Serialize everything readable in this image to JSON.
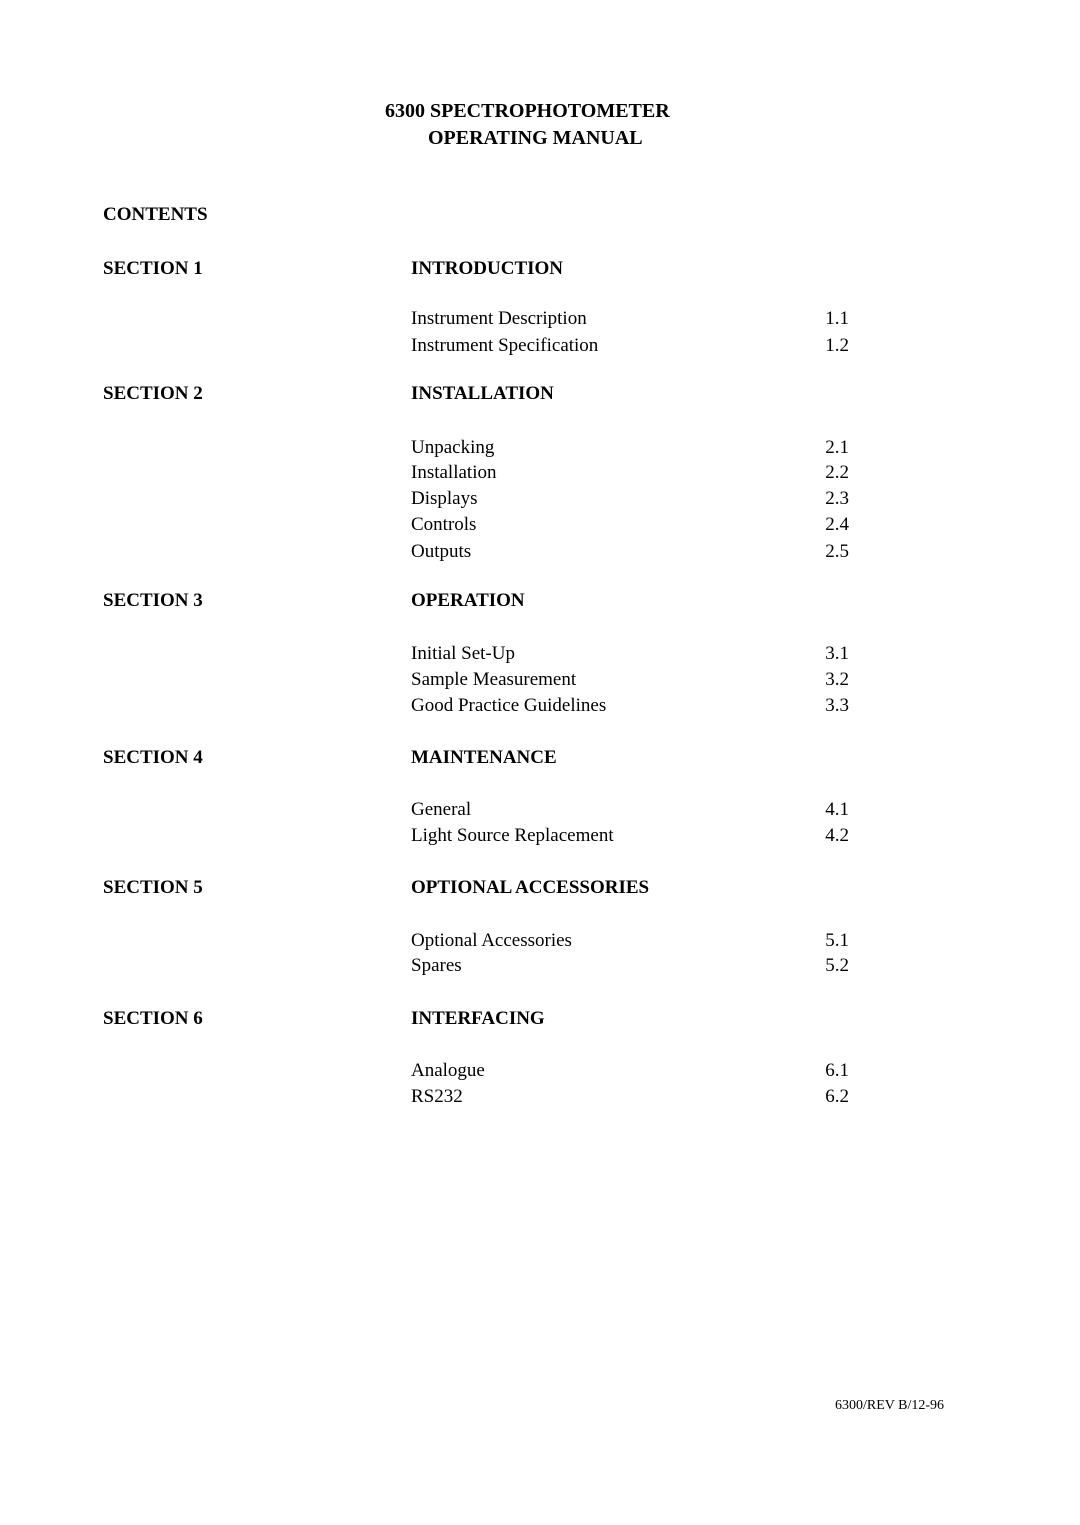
{
  "document": {
    "title_line1": "6300 SPECTROPHOTOMETER",
    "title_line2": "OPERATING MANUAL",
    "contents_label": "CONTENTS",
    "footer": "6300/REV  B/12-96"
  },
  "sections": [
    {
      "label": "SECTION 1",
      "title": "INTRODUCTION",
      "items": [
        {
          "name": "Instrument Description",
          "num": "1.1"
        },
        {
          "name": "Instrument Specification",
          "num": "1.2"
        }
      ]
    },
    {
      "label": "SECTION 2",
      "title": "INSTALLATION",
      "items": [
        {
          "name": "Unpacking",
          "num": "2.1"
        },
        {
          "name": "Installation",
          "num": "2.2"
        },
        {
          "name": "Displays",
          "num": "2.3"
        },
        {
          "name": "Controls",
          "num": "2.4"
        },
        {
          "name": "Outputs",
          "num": "2.5"
        }
      ]
    },
    {
      "label": "SECTION 3",
      "title": "OPERATION",
      "items": [
        {
          "name": "Initial Set-Up",
          "num": "3.1"
        },
        {
          "name": "Sample Measurement",
          "num": "3.2"
        },
        {
          "name": "Good Practice Guidelines",
          "num": "3.3"
        }
      ]
    },
    {
      "label": "SECTION 4",
      "title": "MAINTENANCE",
      "items": [
        {
          "name": "General",
          "num": "4.1"
        },
        {
          "name": "Light Source Replacement",
          "num": "4.2"
        }
      ]
    },
    {
      "label": "SECTION 5",
      "title": "OPTIONAL ACCESSORIES",
      "items": [
        {
          "name": "Optional Accessories",
          "num": "5.1"
        },
        {
          "name": "Spares",
          "num": "5.2"
        }
      ]
    },
    {
      "label": "SECTION 6",
      "title": "INTERFACING",
      "items": [
        {
          "name": "Analogue",
          "num": "6.1"
        },
        {
          "name": "RS232",
          "num": "6.2"
        }
      ]
    }
  ]
}
